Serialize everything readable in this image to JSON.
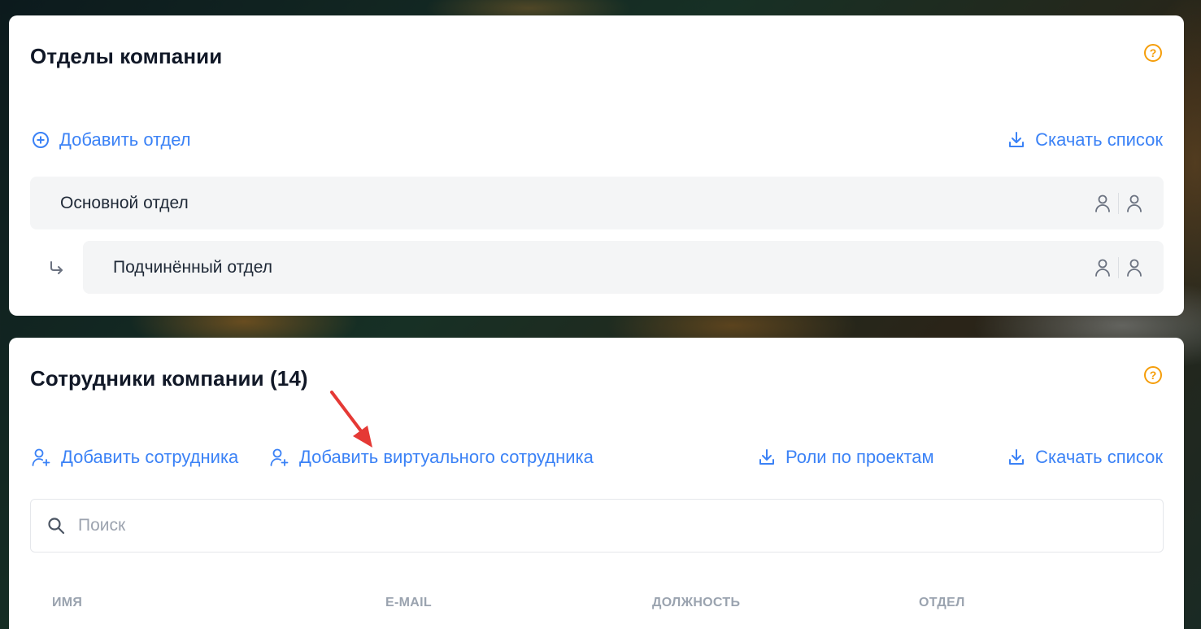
{
  "departments": {
    "title": "Отделы компании",
    "help_icon": "?",
    "add_label": "Добавить отдел",
    "download_label": "Скачать список",
    "items": [
      {
        "label": "Основной отдел",
        "level": 0
      },
      {
        "label": "Подчинённый отдел",
        "level": 1
      }
    ]
  },
  "employees": {
    "title": "Сотрудники компании (14)",
    "help_icon": "?",
    "add_label": "Добавить сотрудника",
    "add_virtual_label": "Добавить виртуального сотрудника",
    "roles_label": "Роли по проектам",
    "download_label": "Скачать список",
    "search_placeholder": "Поиск",
    "columns": [
      "ИМЯ",
      "E-MAIL",
      "ДОЛЖНОСТЬ",
      "ОТДЕЛ"
    ]
  },
  "colors": {
    "accent": "#3b82f6",
    "help": "#f59e0b",
    "annotation_arrow": "#e53935"
  }
}
